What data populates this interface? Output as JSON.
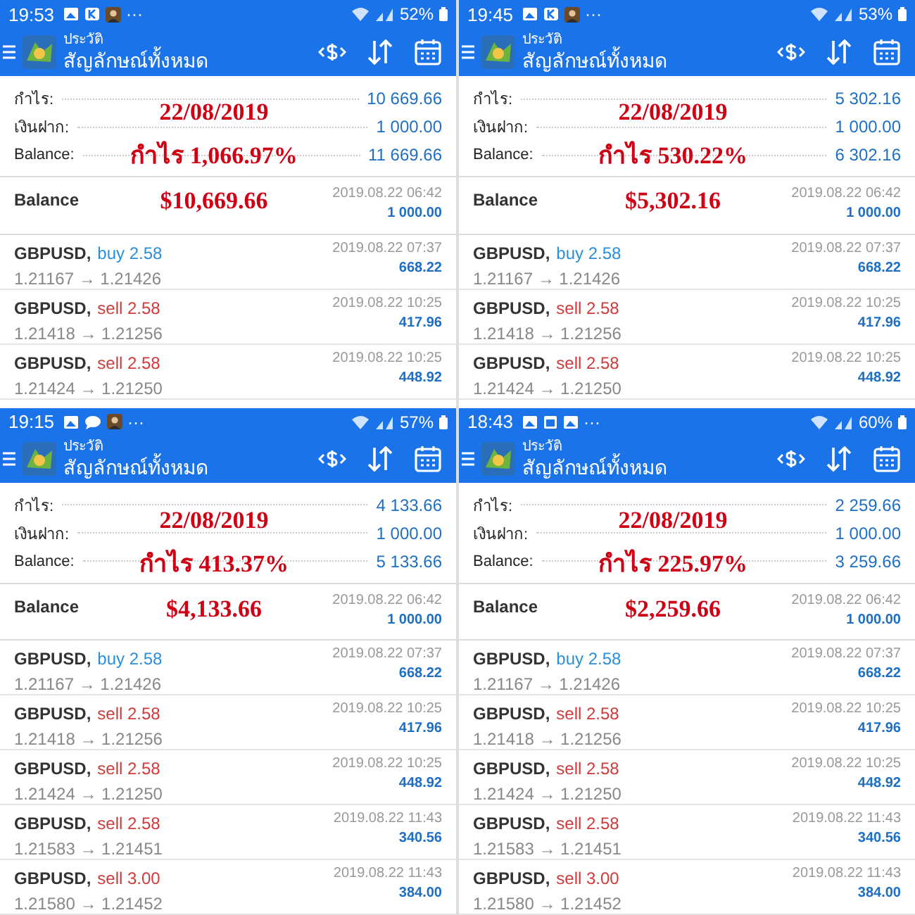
{
  "panels": [
    {
      "status_bar": {
        "time": "19:53",
        "notifications": [
          {
            "kind": "image"
          },
          {
            "kind": "app"
          },
          {
            "kind": "photo"
          }
        ],
        "more": "···",
        "battery": "52%"
      },
      "app_bar": {
        "subtitle": "ประวัติ",
        "title": "สัญลักษณ์ทั้งหมด"
      },
      "summary": [
        {
          "label": "กำไร:",
          "value": "10 669.66"
        },
        {
          "label": "เงินฝาก:",
          "value": "1 000.00"
        },
        {
          "label": "Balance:",
          "value": "11 669.66"
        }
      ],
      "balance": {
        "label": "Balance",
        "time": "2019.08.22 06:42",
        "amount": "1 000.00"
      },
      "overlay": {
        "date": "22/08/2019",
        "profit": "กำไร 1,066.97%",
        "amount": "$10,669.66"
      },
      "trades": [
        {
          "symbol": "GBPUSD,",
          "kind": "buy",
          "order": "buy 2.58",
          "prices": "1.21167 → 1.21426",
          "time": "2019.08.22 07:37",
          "profit": "668.22"
        },
        {
          "symbol": "GBPUSD,",
          "kind": "sell",
          "order": "sell 2.58",
          "prices": "1.21418 → 1.21256",
          "time": "2019.08.22 10:25",
          "profit": "417.96"
        },
        {
          "symbol": "GBPUSD,",
          "kind": "sell",
          "order": "sell 2.58",
          "prices": "1.21424 → 1.21250",
          "time": "2019.08.22 10:25",
          "profit": "448.92"
        }
      ]
    },
    {
      "status_bar": {
        "time": "19:45",
        "notifications": [
          {
            "kind": "image"
          },
          {
            "kind": "app"
          },
          {
            "kind": "photo"
          }
        ],
        "more": "···",
        "battery": "53%"
      },
      "app_bar": {
        "subtitle": "ประวัติ",
        "title": "สัญลักษณ์ทั้งหมด"
      },
      "summary": [
        {
          "label": "กำไร:",
          "value": "5 302.16"
        },
        {
          "label": "เงินฝาก:",
          "value": "1 000.00"
        },
        {
          "label": "Balance:",
          "value": "6 302.16"
        }
      ],
      "balance": {
        "label": "Balance",
        "time": "2019.08.22 06:42",
        "amount": "1 000.00"
      },
      "overlay": {
        "date": "22/08/2019",
        "profit": "กำไร 530.22%",
        "amount": "$5,302.16"
      },
      "trades": [
        {
          "symbol": "GBPUSD,",
          "kind": "buy",
          "order": "buy 2.58",
          "prices": "1.21167 → 1.21426",
          "time": "2019.08.22 07:37",
          "profit": "668.22"
        },
        {
          "symbol": "GBPUSD,",
          "kind": "sell",
          "order": "sell 2.58",
          "prices": "1.21418 → 1.21256",
          "time": "2019.08.22 10:25",
          "profit": "417.96"
        },
        {
          "symbol": "GBPUSD,",
          "kind": "sell",
          "order": "sell 2.58",
          "prices": "1.21424 → 1.21250",
          "time": "2019.08.22 10:25",
          "profit": "448.92"
        }
      ]
    },
    {
      "status_bar": {
        "time": "19:15",
        "notifications": [
          {
            "kind": "image"
          },
          {
            "kind": "chat"
          },
          {
            "kind": "photo"
          }
        ],
        "more": "···",
        "battery": "57%"
      },
      "app_bar": {
        "subtitle": "ประวัติ",
        "title": "สัญลักษณ์ทั้งหมด"
      },
      "summary": [
        {
          "label": "กำไร:",
          "value": "4 133.66"
        },
        {
          "label": "เงินฝาก:",
          "value": "1 000.00"
        },
        {
          "label": "Balance:",
          "value": "5 133.66"
        }
      ],
      "balance": {
        "label": "Balance",
        "time": "2019.08.22 06:42",
        "amount": "1 000.00"
      },
      "overlay": {
        "date": "22/08/2019",
        "profit": "กำไร 413.37%",
        "amount": "$4,133.66"
      },
      "trades": [
        {
          "symbol": "GBPUSD,",
          "kind": "buy",
          "order": "buy 2.58",
          "prices": "1.21167 → 1.21426",
          "time": "2019.08.22 07:37",
          "profit": "668.22"
        },
        {
          "symbol": "GBPUSD,",
          "kind": "sell",
          "order": "sell 2.58",
          "prices": "1.21418 → 1.21256",
          "time": "2019.08.22 10:25",
          "profit": "417.96"
        },
        {
          "symbol": "GBPUSD,",
          "kind": "sell",
          "order": "sell 2.58",
          "prices": "1.21424 → 1.21250",
          "time": "2019.08.22 10:25",
          "profit": "448.92"
        },
        {
          "symbol": "GBPUSD,",
          "kind": "sell",
          "order": "sell 2.58",
          "prices": "1.21583 → 1.21451",
          "time": "2019.08.22 11:43",
          "profit": "340.56"
        },
        {
          "symbol": "GBPUSD,",
          "kind": "sell",
          "order": "sell 3.00",
          "prices": "1.21580 → 1.21452",
          "time": "2019.08.22 11:43",
          "profit": "384.00"
        }
      ]
    },
    {
      "status_bar": {
        "time": "18:43",
        "notifications": [
          {
            "kind": "image"
          },
          {
            "kind": "calendar"
          },
          {
            "kind": "image"
          }
        ],
        "more": "···",
        "battery": "60%"
      },
      "app_bar": {
        "subtitle": "ประวัติ",
        "title": "สัญลักษณ์ทั้งหมด"
      },
      "summary": [
        {
          "label": "กำไร:",
          "value": "2 259.66"
        },
        {
          "label": "เงินฝาก:",
          "value": "1 000.00"
        },
        {
          "label": "Balance:",
          "value": "3 259.66"
        }
      ],
      "balance": {
        "label": "Balance",
        "time": "2019.08.22 06:42",
        "amount": "1 000.00"
      },
      "overlay": {
        "date": "22/08/2019",
        "profit": "กำไร 225.97%",
        "amount": "$2,259.66"
      },
      "trades": [
        {
          "symbol": "GBPUSD,",
          "kind": "buy",
          "order": "buy 2.58",
          "prices": "1.21167 → 1.21426",
          "time": "2019.08.22 07:37",
          "profit": "668.22"
        },
        {
          "symbol": "GBPUSD,",
          "kind": "sell",
          "order": "sell 2.58",
          "prices": "1.21418 → 1.21256",
          "time": "2019.08.22 10:25",
          "profit": "417.96"
        },
        {
          "symbol": "GBPUSD,",
          "kind": "sell",
          "order": "sell 2.58",
          "prices": "1.21424 → 1.21250",
          "time": "2019.08.22 10:25",
          "profit": "448.92"
        },
        {
          "symbol": "GBPUSD,",
          "kind": "sell",
          "order": "sell 2.58",
          "prices": "1.21583 → 1.21451",
          "time": "2019.08.22 11:43",
          "profit": "340.56"
        },
        {
          "symbol": "GBPUSD,",
          "kind": "sell",
          "order": "sell 3.00",
          "prices": "1.21580 → 1.21452",
          "time": "2019.08.22 11:43",
          "profit": "384.00"
        }
      ]
    }
  ]
}
